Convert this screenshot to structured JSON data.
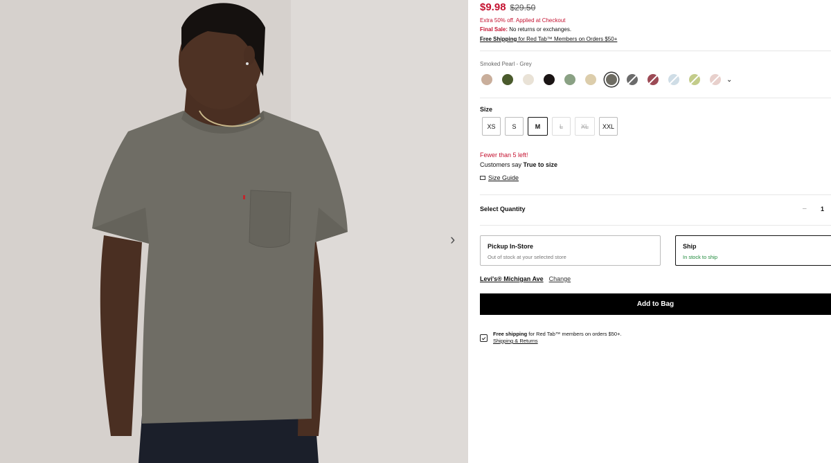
{
  "product_image": {
    "alt_icon": "chevron-right-icon",
    "next_glyph": "›"
  },
  "price": {
    "current": "$9.98",
    "original": "$29.50",
    "promo": "Extra 50% off. Applied at Checkout",
    "final_sale_label": "Final Sale:",
    "final_sale_text": " No returns or exchanges.",
    "free_shipping_label": "Free Shipping",
    "free_shipping_text": " for Red Tab™ Members on Orders $50+"
  },
  "color": {
    "selected_name": "Smoked Pearl - Grey",
    "swatches": [
      {
        "color": "#c9ae9b",
        "striped": false,
        "selected": false
      },
      {
        "color": "#4a5a2c",
        "striped": false,
        "selected": false
      },
      {
        "color": "#e9e2d6",
        "striped": false,
        "selected": false
      },
      {
        "color": "#1a1414",
        "striped": false,
        "selected": false
      },
      {
        "color": "#8aa184",
        "striped": false,
        "selected": false
      },
      {
        "color": "#dccdab",
        "striped": false,
        "selected": false
      },
      {
        "color": "#6e6c63",
        "striped": false,
        "selected": true
      },
      {
        "color": "#6b6b6b",
        "striped": true,
        "selected": false
      },
      {
        "color": "#9c4a55",
        "striped": true,
        "selected": false
      },
      {
        "color": "#cfdde6",
        "striped": true,
        "selected": false
      },
      {
        "color": "#c3cc8a",
        "striped": true,
        "selected": false
      },
      {
        "color": "#e8d0cc",
        "striped": true,
        "selected": false
      }
    ],
    "more_glyph": "⌄"
  },
  "size": {
    "label": "Size",
    "options": [
      {
        "label": "XS",
        "state": "available"
      },
      {
        "label": "S",
        "state": "available"
      },
      {
        "label": "M",
        "state": "selected"
      },
      {
        "label": "L",
        "state": "oos"
      },
      {
        "label": "XL",
        "state": "oos"
      },
      {
        "label": "XXL",
        "state": "available"
      }
    ],
    "stock_warning": "Fewer than 5 left!",
    "fit_prefix": "Customers say ",
    "fit_value": "True to size",
    "guide_label": "Size Guide"
  },
  "quantity": {
    "label": "Select Quantity",
    "minus": "–",
    "value": "1"
  },
  "fulfillment": {
    "pickup_title": "Pickup In-Store",
    "pickup_status": "Out of stock at your selected store",
    "ship_title": "Ship",
    "ship_status": "In stock to ship",
    "store_name": "Levi's® Michigan Ave",
    "change_label": "Change"
  },
  "add_to_bag_label": "Add to Bag",
  "shipping_info": {
    "bold": "Free shipping",
    "text": " for Red Tab™ members on orders $50+.",
    "link": "Shipping & Returns"
  }
}
